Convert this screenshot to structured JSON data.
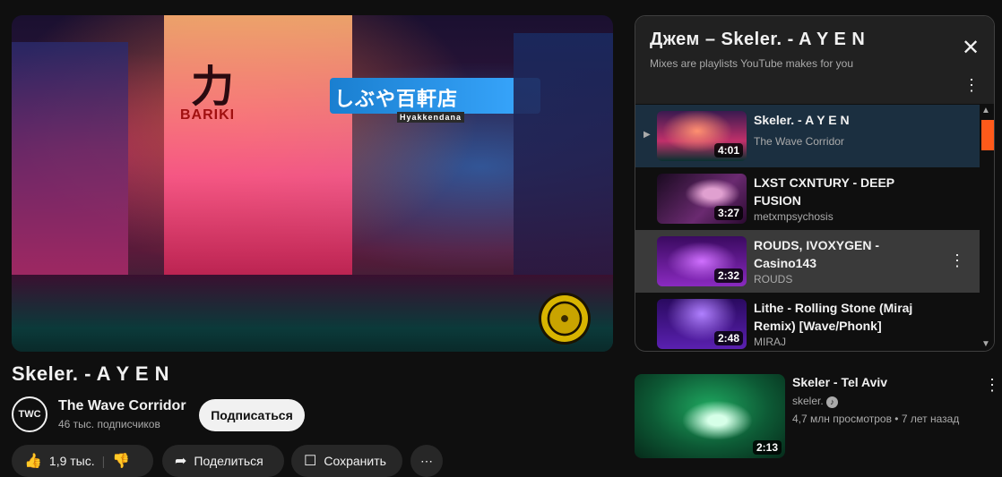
{
  "video": {
    "title": "Skeler. - A Y E N",
    "channel": "The Wave Corridor",
    "channel_initials": "TWC",
    "subscribers": "46 тыс. подписчиков",
    "subscribe_label": "Подписаться",
    "like_count": "1,9 тыс.",
    "share_label": "Поделиться",
    "save_label": "Сохранить",
    "thumbnail_signs": [
      "力",
      "BARIKI",
      "しぶや百軒店",
      "Hyakkendana"
    ]
  },
  "mix": {
    "title": "Джем – Skeler. - A Y E N",
    "subtitle": "Mixes are playlists YouTube makes for you",
    "items": [
      {
        "title": "Skeler. - A Y E N",
        "channel": "The Wave Corridor",
        "duration": "4:01"
      },
      {
        "title": "LXST CXNTURY - DEEP FUSION",
        "channel": "metxmpsychosis",
        "duration": "3:27"
      },
      {
        "title": "ROUDS, IVOXYGEN - Casino143",
        "channel": "ROUDS",
        "duration": "2:32"
      },
      {
        "title": "Lithe - Rolling Stone (Miraj Remix) [Wave/Phonk]",
        "channel": "MIRAJ",
        "duration": "2:48"
      }
    ]
  },
  "recommendation": {
    "title": "Skeler - Tel Aviv",
    "channel": "skeler.",
    "meta": "4,7 млн просмотров • 7 лет назад",
    "duration": "2:13"
  },
  "icons": {
    "close": "close-icon",
    "more": "more-vert-icon",
    "play": "play-indicator-icon",
    "like": "thumb-up-icon",
    "dislike": "thumb-down-icon",
    "share": "share-icon",
    "save": "save-icon",
    "verified": "verified-icon"
  },
  "colors": {
    "background": "#0f0f0f",
    "active_row": "#1b2f40",
    "scroll_thumb": "#ff5a1a",
    "subscribe_bg": "#f1f1f1"
  }
}
